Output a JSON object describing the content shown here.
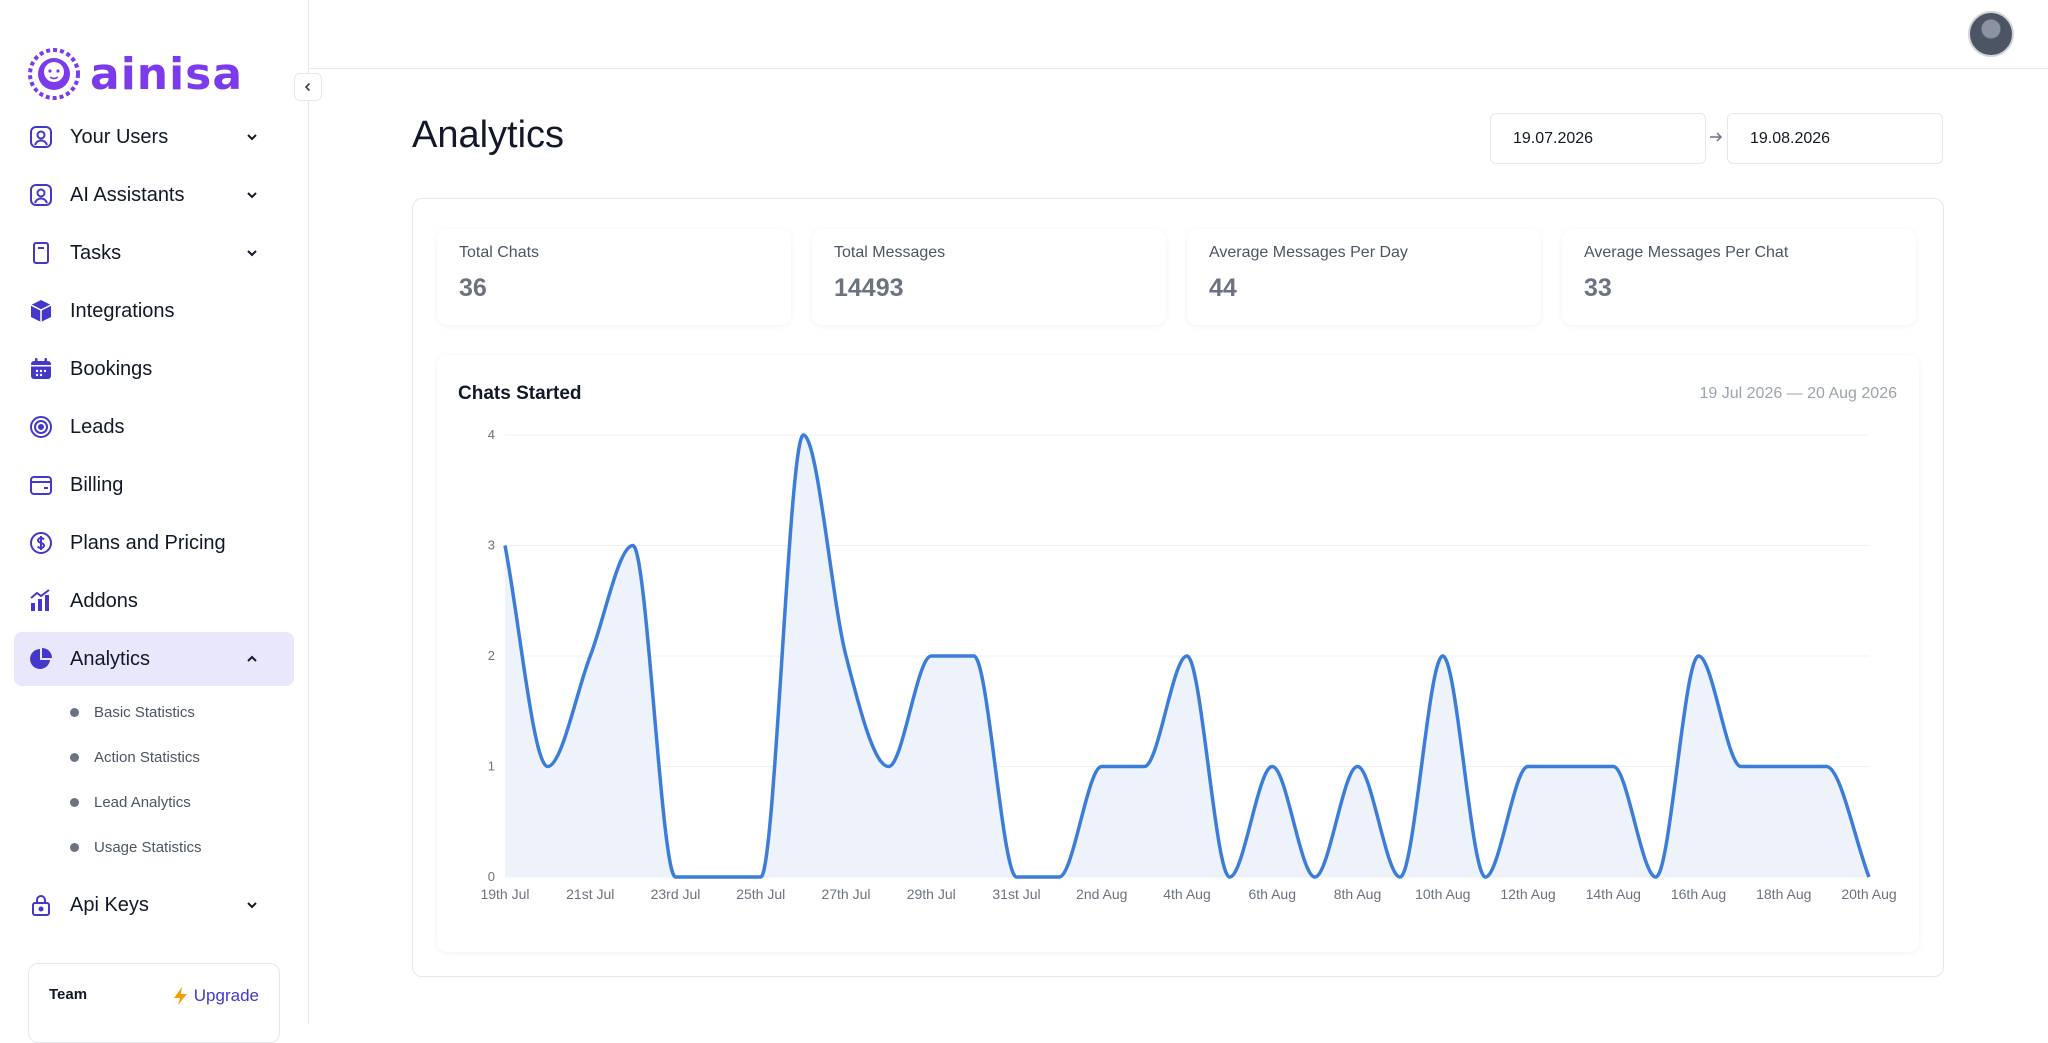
{
  "brand": {
    "name": "ainisa",
    "accent": "#7c3aed"
  },
  "sidebar": {
    "items": [
      {
        "label": "Your Users",
        "icon": "user-square-icon",
        "expandable": true
      },
      {
        "label": "AI Assistants",
        "icon": "user-square-icon",
        "expandable": true
      },
      {
        "label": "Tasks",
        "icon": "clipboard-icon",
        "expandable": true
      },
      {
        "label": "Integrations",
        "icon": "cube-icon",
        "expandable": false
      },
      {
        "label": "Bookings",
        "icon": "calendar-icon",
        "expandable": false
      },
      {
        "label": "Leads",
        "icon": "target-icon",
        "expandable": false
      },
      {
        "label": "Billing",
        "icon": "wallet-icon",
        "expandable": false
      },
      {
        "label": "Plans and Pricing",
        "icon": "dollar-circle-icon",
        "expandable": false
      },
      {
        "label": "Addons",
        "icon": "bar-chart-icon",
        "expandable": false
      },
      {
        "label": "Analytics",
        "icon": "pie-chart-icon",
        "expandable": true,
        "active": true
      }
    ],
    "analytics_sub": [
      "Basic Statistics",
      "Action Statistics",
      "Lead Analytics",
      "Usage Statistics"
    ],
    "api_keys": {
      "label": "Api Keys",
      "icon": "lock-icon"
    }
  },
  "team_card": {
    "label": "Team",
    "upgrade_label": "Upgrade"
  },
  "header": {
    "title": "Analytics",
    "date_from": "19.07.2026",
    "date_to": "19.08.2026"
  },
  "stats": [
    {
      "label": "Total Chats",
      "value": "36"
    },
    {
      "label": "Total Messages",
      "value": "14493"
    },
    {
      "label": "Average Messages Per Day",
      "value": "44"
    },
    {
      "label": "Average Messages Per Chat",
      "value": "33"
    }
  ],
  "chart_card": {
    "title": "Chats Started",
    "range": "19 Jul 2026 — 20 Aug 2026"
  },
  "chart_data": {
    "type": "area",
    "title": "Chats Started",
    "x": [
      "19th Jul",
      "20th Jul",
      "21st Jul",
      "22nd Jul",
      "23rd Jul",
      "24th Jul",
      "25th Jul",
      "26th Jul",
      "27th Jul",
      "28th Jul",
      "29th Jul",
      "30th Jul",
      "31st Jul",
      "1st Aug",
      "2nd Aug",
      "3rd Aug",
      "4th Aug",
      "5th Aug",
      "6th Aug",
      "7th Aug",
      "8th Aug",
      "9th Aug",
      "10th Aug",
      "11th Aug",
      "12th Aug",
      "13th Aug",
      "14th Aug",
      "15th Aug",
      "16th Aug",
      "17th Aug",
      "18th Aug",
      "19th Aug",
      "20th Aug"
    ],
    "values": [
      3,
      1,
      2,
      3,
      0,
      0,
      0,
      4,
      2,
      1,
      2,
      2,
      0,
      0,
      1,
      1,
      2,
      0,
      1,
      0,
      1,
      0,
      2,
      0,
      1,
      1,
      1,
      0,
      2,
      1,
      1,
      1,
      0
    ],
    "x_tick_labels": [
      "19th Jul",
      "21st Jul",
      "23rd Jul",
      "25th Jul",
      "27th Jul",
      "29th Jul",
      "31st Jul",
      "2nd Aug",
      "4th Aug",
      "6th Aug",
      "8th Aug",
      "10th Aug",
      "12th Aug",
      "14th Aug",
      "16th Aug",
      "18th Aug",
      "20th Aug"
    ],
    "y_ticks": [
      0,
      1,
      2,
      3,
      4
    ],
    "ylim": [
      0,
      4
    ],
    "grid": true,
    "line_color": "#3b7dd8",
    "fill_color": "#eef2fb"
  }
}
